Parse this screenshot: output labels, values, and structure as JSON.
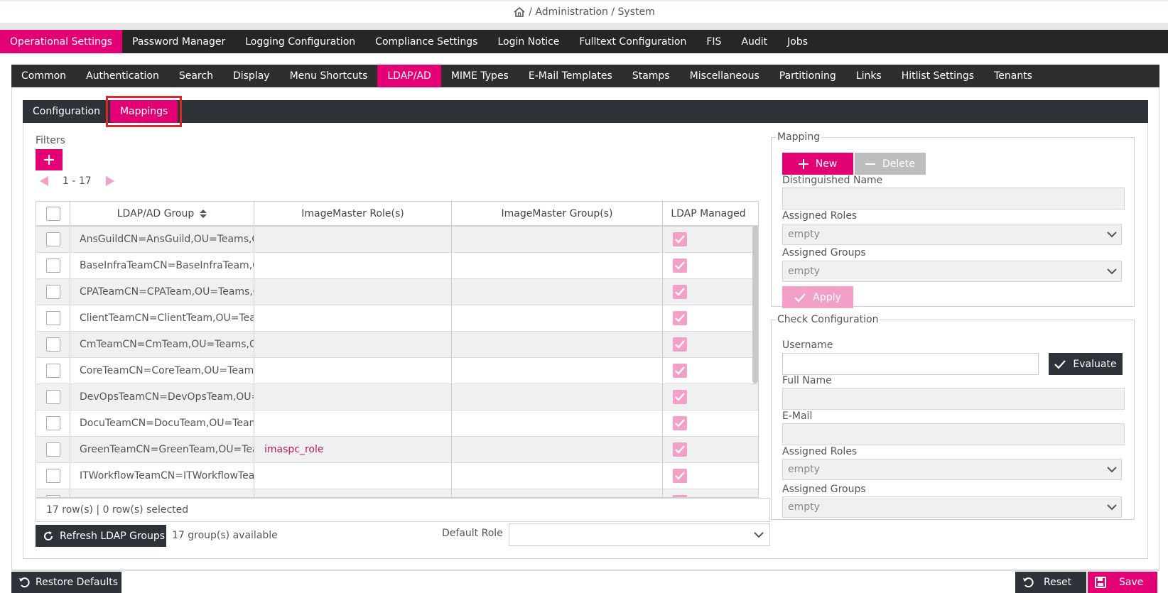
{
  "breadcrumb": {
    "home_icon": "home-icon",
    "path": "/ Administration / System"
  },
  "main_tabs": [
    {
      "label": "Operational Settings",
      "active": true
    },
    {
      "label": "Password Manager"
    },
    {
      "label": "Logging Configuration"
    },
    {
      "label": "Compliance Settings"
    },
    {
      "label": "Login Notice"
    },
    {
      "label": "Fulltext Configuration"
    },
    {
      "label": "FIS"
    },
    {
      "label": "Audit"
    },
    {
      "label": "Jobs"
    }
  ],
  "sub_tabs": [
    {
      "label": "Common"
    },
    {
      "label": "Authentication"
    },
    {
      "label": "Search"
    },
    {
      "label": "Display"
    },
    {
      "label": "Menu Shortcuts"
    },
    {
      "label": "LDAP/AD",
      "active": true
    },
    {
      "label": "MIME Types"
    },
    {
      "label": "E-Mail Templates"
    },
    {
      "label": "Stamps"
    },
    {
      "label": "Miscellaneous"
    },
    {
      "label": "Partitioning"
    },
    {
      "label": "Links"
    },
    {
      "label": "Hitlist Settings"
    },
    {
      "label": "Tenants"
    }
  ],
  "inner_tabs": [
    {
      "label": "Configuration"
    },
    {
      "label": "Mappings",
      "active": true
    }
  ],
  "filters": {
    "label": "Filters",
    "add_icon": "plus-icon"
  },
  "pager": {
    "range": "1 - 17"
  },
  "grid": {
    "columns": [
      "LDAP/AD Group",
      "ImageMaster Role(s)",
      "ImageMaster Group(s)",
      "LDAP Managed"
    ],
    "rows": [
      {
        "group": "AnsGuildCN=AnsGuild,OU=Teams,OU=",
        "roles": "",
        "groups": "",
        "managed": true
      },
      {
        "group": "BaseInfraTeamCN=BaseInfraTeam,OU=",
        "roles": "",
        "groups": "",
        "managed": true
      },
      {
        "group": "CPATeamCN=CPATeam,OU=Teams,OU=",
        "roles": "",
        "groups": "",
        "managed": true
      },
      {
        "group": "ClientTeamCN=ClientTeam,OU=Teams,",
        "roles": "",
        "groups": "",
        "managed": true
      },
      {
        "group": "CmTeamCN=CmTeam,OU=Teams,OU=C",
        "roles": "",
        "groups": "",
        "managed": true
      },
      {
        "group": "CoreTeamCN=CoreTeam,OU=Teams,OU",
        "roles": "",
        "groups": "",
        "managed": true
      },
      {
        "group": "DevOpsTeamCN=DevOpsTeam,OU=Tea",
        "roles": "",
        "groups": "",
        "managed": true
      },
      {
        "group": "DocuTeamCN=DocuTeam,OU=Teams,O",
        "roles": "",
        "groups": "",
        "managed": true
      },
      {
        "group": "GreenTeamCN=GreenTeam,OU=Teams,",
        "roles": "imaspc_role",
        "groups": "",
        "managed": true
      },
      {
        "group": "ITWorkflowTeamCN=ITWorkflowTeam,(",
        "roles": "",
        "groups": "",
        "managed": true
      },
      {
        "group": "",
        "roles": "",
        "groups": "",
        "managed": true
      }
    ],
    "status": "17 row(s) | 0 row(s) selected"
  },
  "refresh": {
    "label": "Refresh LDAP Groups",
    "available": "17 group(s) available"
  },
  "default_role": {
    "label": "Default Role",
    "value": ""
  },
  "mapping": {
    "legend": "Mapping",
    "new_label": "New",
    "delete_label": "Delete",
    "dn_label": "Distinguished Name",
    "roles_label": "Assigned Roles",
    "roles_value": "empty",
    "groups_label": "Assigned Groups",
    "groups_value": "empty",
    "apply_label": "Apply"
  },
  "check": {
    "legend": "Check Configuration",
    "username_label": "Username",
    "evaluate_label": "Evaluate",
    "fullname_label": "Full Name",
    "email_label": "E-Mail",
    "roles_label": "Assigned Roles",
    "roles_value": "empty",
    "groups_label": "Assigned Groups",
    "groups_value": "empty"
  },
  "footer": {
    "restore_label": "Restore Defaults",
    "reset_label": "Reset",
    "save_label": "Save"
  },
  "colors": {
    "accent": "#e20074",
    "accent_light": "#f2a0c8",
    "dark": "#262626",
    "dark_button": "#2e333a"
  }
}
